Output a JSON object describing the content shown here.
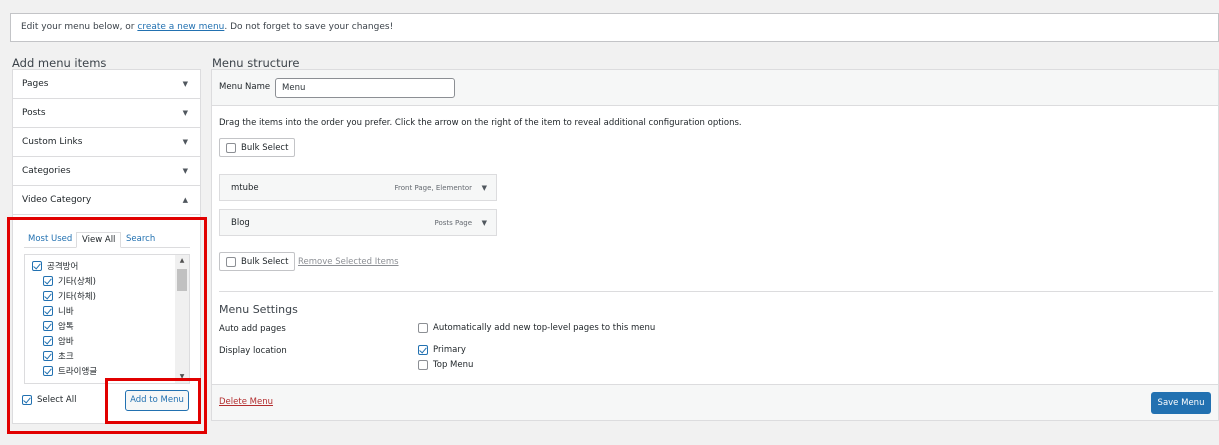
{
  "notice": {
    "text_before": "Edit your menu below, or ",
    "link": "create a new menu",
    "text_after": ". Do not forget to save your changes!"
  },
  "add_items": {
    "heading": "Add menu items",
    "sections": [
      {
        "label": "Pages",
        "arrow": "▼"
      },
      {
        "label": "Posts",
        "arrow": "▼"
      },
      {
        "label": "Custom Links",
        "arrow": "▼"
      },
      {
        "label": "Categories",
        "arrow": "▼"
      },
      {
        "label": "Video Category",
        "arrow": "▲"
      }
    ],
    "tabs": [
      "Most Used",
      "View All",
      "Search"
    ],
    "active_tab": "View All",
    "checklist": [
      {
        "label": "공격방어",
        "checked": true,
        "level": 0
      },
      {
        "label": "기타(상체)",
        "checked": true,
        "level": 1
      },
      {
        "label": "기타(하체)",
        "checked": true,
        "level": 1
      },
      {
        "label": "니바",
        "checked": true,
        "level": 1
      },
      {
        "label": "암톡",
        "checked": true,
        "level": 1
      },
      {
        "label": "암바",
        "checked": true,
        "level": 1
      },
      {
        "label": "초크",
        "checked": true,
        "level": 1
      },
      {
        "label": "트라이앵글",
        "checked": true,
        "level": 1
      }
    ],
    "select_all": {
      "label": "Select All",
      "checked": true
    },
    "add_button": "Add to Menu"
  },
  "structure": {
    "heading": "Menu structure",
    "menu_name_label": "Menu Name",
    "menu_name_value": "Menu",
    "instructions": "Drag the items into the order you prefer. Click the arrow on the right of the item to reveal additional configuration options.",
    "bulk_select": "Bulk Select",
    "items": [
      {
        "title": "mtube",
        "type": "Front Page, Elementor"
      },
      {
        "title": "Blog",
        "type": "Posts Page"
      }
    ],
    "remove_selected": "Remove Selected Items",
    "settings": {
      "title": "Menu Settings",
      "auto_add_label": "Auto add pages",
      "auto_add_option": "Automatically add new top-level pages to this menu",
      "display_location_label": "Display location",
      "locations": [
        {
          "label": "Primary",
          "checked": true
        },
        {
          "label": "Top Menu",
          "checked": false
        }
      ]
    },
    "delete_menu": "Delete Menu",
    "save_menu": "Save Menu"
  },
  "colors": {
    "accent": "#2271b1",
    "highlight": "#e10000",
    "danger": "#b32d2e"
  }
}
